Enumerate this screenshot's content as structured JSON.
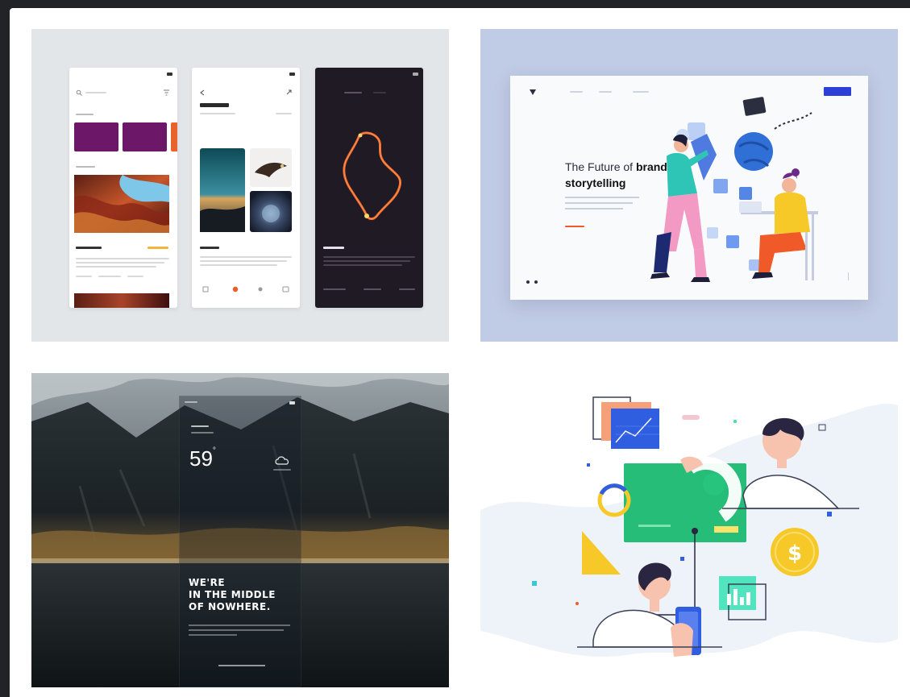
{
  "landing": {
    "headline_regular": "The Future of",
    "headline_bold_1": "brand",
    "headline_bold_2": "storytelling"
  },
  "weather": {
    "temperature": "59",
    "degree": "°",
    "headline_line1": "WE'RE",
    "headline_line2": "IN THE MIDDLE",
    "headline_line3": "OF NOWHERE."
  },
  "finance": {
    "coin_symbol": "$"
  },
  "colors": {
    "page_bg": "#222327",
    "purple_card": "#6d1768",
    "landing_bg": "#c0cbe5",
    "landing_cta_blue": "#2c3fd6",
    "dark_phone": "#1f1a24",
    "route_orange": "#f0672a",
    "finance_green": "#27c47e",
    "coin_yellow": "#f7c928"
  }
}
